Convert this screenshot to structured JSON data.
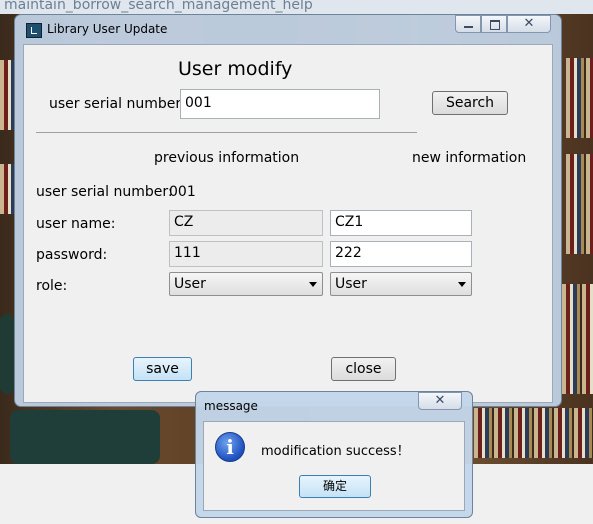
{
  "background": {
    "window_title": "maintain_borrow_search_management_help"
  },
  "main_window": {
    "title": "Library User Update",
    "heading": "User modify",
    "search_label": "user serial number:",
    "search_value": "001",
    "search_button": "Search",
    "previous_header": "previous information",
    "new_header": "new information",
    "serial_label": "user serial number:",
    "serial_value": "001",
    "username_label": "user name:",
    "password_label": "password:",
    "role_label": "role:",
    "previous": {
      "username": "CZ",
      "password": "111",
      "role": "User"
    },
    "new": {
      "username": "CZ1",
      "password": "222",
      "role": "User"
    },
    "save_button": "save",
    "close_button": "close"
  },
  "message_dialog": {
    "title": "message",
    "icon": "info-icon",
    "text": "modification success！",
    "ok_button": "确定"
  }
}
